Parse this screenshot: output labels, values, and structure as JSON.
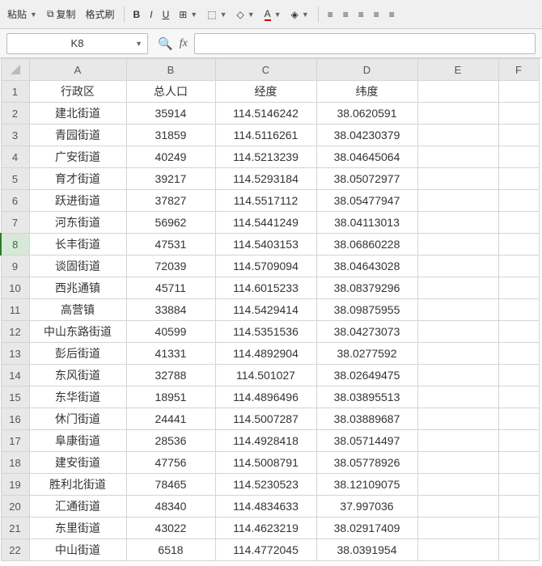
{
  "toolbar": {
    "paste": "粘贴",
    "copy": "复制",
    "formatPainter": "格式刷"
  },
  "namebox": {
    "value": "K8"
  },
  "fxlabel": "fx",
  "columns": [
    "A",
    "B",
    "C",
    "D",
    "E",
    "F"
  ],
  "selectedRow": 8,
  "headers": [
    "行政区",
    "总人口",
    "经度",
    "纬度"
  ],
  "rows": [
    [
      "建北街道",
      "35914",
      "114.5146242",
      "38.0620591"
    ],
    [
      "青园街道",
      "31859",
      "114.5116261",
      "38.04230379"
    ],
    [
      "广安街道",
      "40249",
      "114.5213239",
      "38.04645064"
    ],
    [
      "育才街道",
      "39217",
      "114.5293184",
      "38.05072977"
    ],
    [
      "跃进街道",
      "37827",
      "114.5517112",
      "38.05477947"
    ],
    [
      "河东街道",
      "56962",
      "114.5441249",
      "38.04113013"
    ],
    [
      "长丰街道",
      "47531",
      "114.5403153",
      "38.06860228"
    ],
    [
      "谈固街道",
      "72039",
      "114.5709094",
      "38.04643028"
    ],
    [
      "西兆通镇",
      "45711",
      "114.6015233",
      "38.08379296"
    ],
    [
      "高营镇",
      "33884",
      "114.5429414",
      "38.09875955"
    ],
    [
      "中山东路街道",
      "40599",
      "114.5351536",
      "38.04273073"
    ],
    [
      "彭后街道",
      "41331",
      "114.4892904",
      "38.0277592"
    ],
    [
      "东风街道",
      "32788",
      "114.501027",
      "38.02649475"
    ],
    [
      "东华街道",
      "18951",
      "114.4896496",
      "38.03895513"
    ],
    [
      "休门街道",
      "24441",
      "114.5007287",
      "38.03889687"
    ],
    [
      "阜康街道",
      "28536",
      "114.4928418",
      "38.05714497"
    ],
    [
      "建安街道",
      "47756",
      "114.5008791",
      "38.05778926"
    ],
    [
      "胜利北街道",
      "78465",
      "114.5230523",
      "38.12109075"
    ],
    [
      "汇通街道",
      "48340",
      "114.4834633",
      "37.997036"
    ],
    [
      "东里街道",
      "43022",
      "114.4623219",
      "38.02917409"
    ],
    [
      "中山街道",
      "6518",
      "114.4772045",
      "38.0391954"
    ]
  ]
}
